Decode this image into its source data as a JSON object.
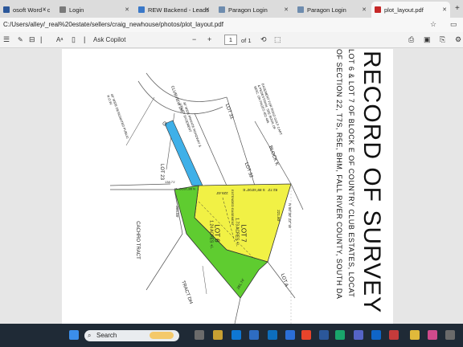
{
  "browser": {
    "tabs": [
      {
        "label": "osoft Word - consur"
      },
      {
        "label": "Login"
      },
      {
        "label": "REW Backend - Leads"
      },
      {
        "label": "Paragon Login"
      },
      {
        "label": "Paragon Login"
      },
      {
        "label": "plot_layout.pdf"
      }
    ],
    "address": "C:/Users/alley/_real%20estate/sellers/craig_newhouse/photos/plot_layout.pdf"
  },
  "pdf_toolbar": {
    "ask_copilot": "Ask Copilot",
    "page_current": "1",
    "page_total": "of 1",
    "read_aloud": "Aᵃ"
  },
  "survey": {
    "title": "RECORD OF SURVEY",
    "subtitle_1": "LOT 6 & LOT 7 OF BLOCK E OF COUNTRY CLUB ESTATES, LOCAT",
    "subtitle_2": "OF SECTION 22, T7S, R5E, BHM, FALL RIVER COUNTY, SOUTH DA",
    "lot7_label": "LOT 7",
    "lot7_acres": "1.73 ACRES +/-",
    "lot6_label": "LOT 6",
    "lot6_acres": "1.24 ACRES +/-",
    "lot23": "LOT 23",
    "lot31": "LOT 31",
    "lot32": "LOT 32",
    "block_k": "BLOCK K",
    "lot_a": "LOT A",
    "tract_dh": "TRACT DH",
    "cachro_tract": "CACHRO TRACT",
    "road": "CLUBVIEW DR.",
    "easement_1": "EASEMENT FOR ROAD GOLF CART & PEDESTRIAN. SEE BOOK OF MISC. ON PAGES 482-485.",
    "easement_2": "30' WIDE PRIVATE ROADWAY & UTILITY EASEMENT",
    "row_text": "60' WIDE DESIGNATED PUBLIC R.O.W.",
    "extended_easement": "EXTENDED EASEMENT",
    "dims": {
      "top": "138.71'",
      "bearing_top": "N 88°15'00\" W",
      "d229": "229.40'",
      "d3920": "S 89°40'00\" E",
      "d8272": "82.72'",
      "d22180": "221.80'",
      "right_bearing": "N 00°30' 23\" W",
      "bottom": "281.74'",
      "left": "304.58'"
    }
  },
  "taskbar": {
    "search_placeholder": "Search"
  },
  "colors": {
    "lot7": "#f1f145",
    "lot6": "#5fcc30",
    "road": "#3fb0e8"
  }
}
